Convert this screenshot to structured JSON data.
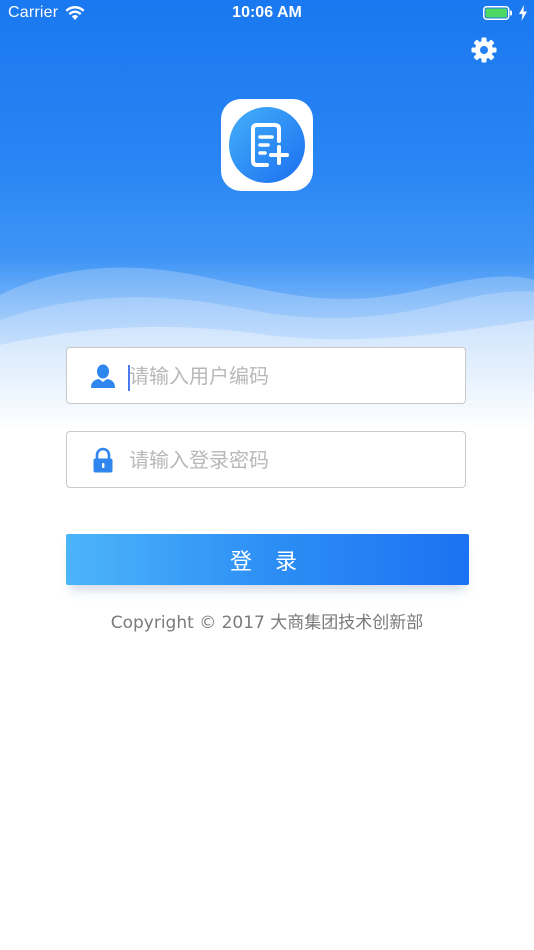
{
  "status_bar": {
    "carrier": "Carrier",
    "time": "10:06 AM",
    "battery_color": "#4cd964"
  },
  "header": {
    "settings_icon": "gear-icon",
    "logo_icon": "document-plus-icon",
    "background_color": "#1a78f0"
  },
  "form": {
    "username": {
      "icon": "user-icon",
      "placeholder": "请输入用户编码",
      "value": ""
    },
    "password": {
      "icon": "lock-icon",
      "placeholder": "请输入登录密码",
      "value": ""
    },
    "login_label": "登 录"
  },
  "footer": {
    "copyright": "Copyright © 2017 大商集团技术创新部"
  }
}
